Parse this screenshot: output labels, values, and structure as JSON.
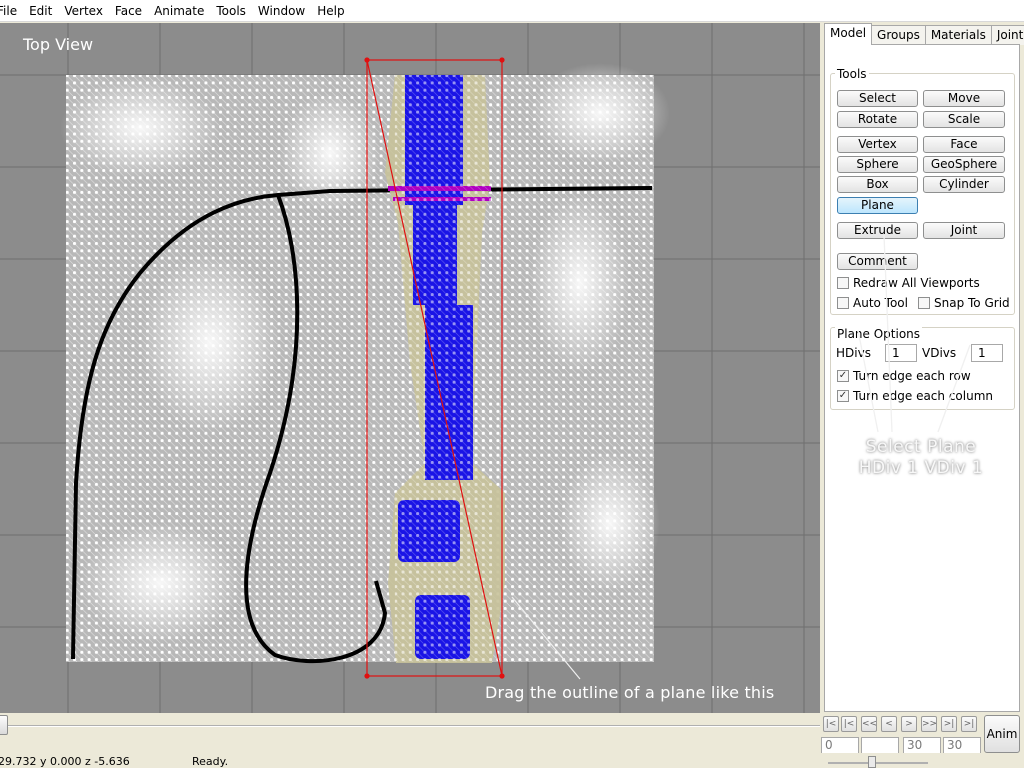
{
  "menu": [
    "File",
    "Edit",
    "Vertex",
    "Face",
    "Animate",
    "Tools",
    "Window",
    "Help"
  ],
  "viewport": {
    "title": "Top View",
    "annotation": "Drag the outline of a plane like this"
  },
  "callout": {
    "line1": "Select Plane",
    "line2": "HDiv 1 VDiv 1"
  },
  "panel": {
    "tabs": [
      "Model",
      "Groups",
      "Materials",
      "Joints"
    ],
    "active_tab": "Model",
    "tools_title": "Tools",
    "buttons": {
      "select": "Select",
      "move": "Move",
      "rotate": "Rotate",
      "scale": "Scale",
      "vertex": "Vertex",
      "face": "Face",
      "sphere": "Sphere",
      "geosphere": "GeoSphere",
      "box": "Box",
      "cylinder": "Cylinder",
      "plane": "Plane",
      "extrude": "Extrude",
      "joint": "Joint",
      "comment": "Comment"
    },
    "active_tool": "Plane",
    "checkboxes": {
      "redraw_all": {
        "label": "Redraw All Viewports",
        "checked": false
      },
      "auto_tool": {
        "label": "Auto Tool",
        "checked": false
      },
      "snap_grid": {
        "label": "Snap To Grid",
        "checked": false
      }
    },
    "plane_options": {
      "title": "Plane Options",
      "hdivs_label": "HDivs",
      "hdivs_value": "1",
      "vdivs_label": "VDivs",
      "vdivs_value": "1",
      "turn_row": {
        "label": "Turn edge each row",
        "checked": true
      },
      "turn_col": {
        "label": "Turn edge each column",
        "checked": true
      }
    }
  },
  "animation": {
    "frame_current": "0",
    "frame_field2": "",
    "frame_end_a": "30",
    "frame_end_b": "30",
    "anim_label": "Anim",
    "timeline_position": 0
  },
  "status": {
    "coords": "29.732 y 0.000 z -5.636",
    "message": "Ready."
  },
  "colors": {
    "viewport_bg": "#8c8c8c",
    "outline": "#e01010",
    "model_fill": "#1a14e6",
    "selection_band": "#c8c29a"
  }
}
